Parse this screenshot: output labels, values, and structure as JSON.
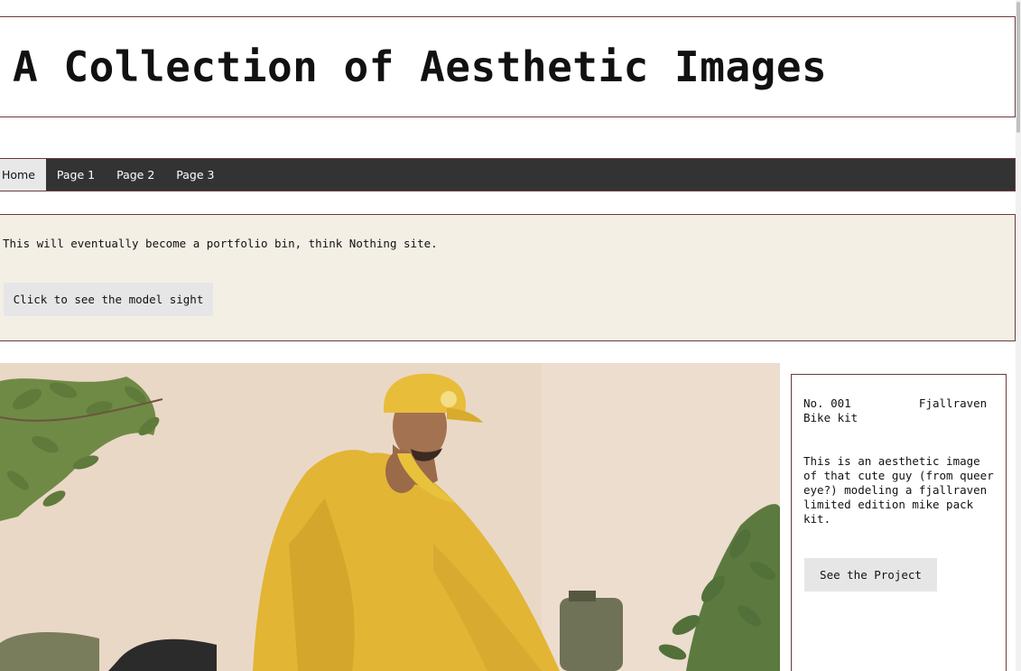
{
  "header": {
    "title": "A Collection of Aesthetic Images"
  },
  "nav": {
    "items": [
      {
        "label": "Home",
        "active": true
      },
      {
        "label": "Page 1",
        "active": false
      },
      {
        "label": "Page 2",
        "active": false
      },
      {
        "label": "Page 3",
        "active": false
      }
    ]
  },
  "intro": {
    "text": "This will eventually become a portfolio bin, think Nothing site.",
    "button_label": "Click to see the model sight"
  },
  "hero": {
    "image_alt": "man in yellow jacket and cap with bike packs"
  },
  "card": {
    "title": "No. 001          Fjallraven Bike kit",
    "description": "This is an aesthetic image of that cute guy (from queer eye?) modeling a fjallraven limited edition mike pack kit.",
    "button_label": "See the Project"
  },
  "colors": {
    "border": "#6b3b3b",
    "nav_bg": "#333333",
    "intro_bg": "#f3efe5",
    "button_bg": "#e6e6e6",
    "jacket_yellow": "#e8bd3a"
  }
}
